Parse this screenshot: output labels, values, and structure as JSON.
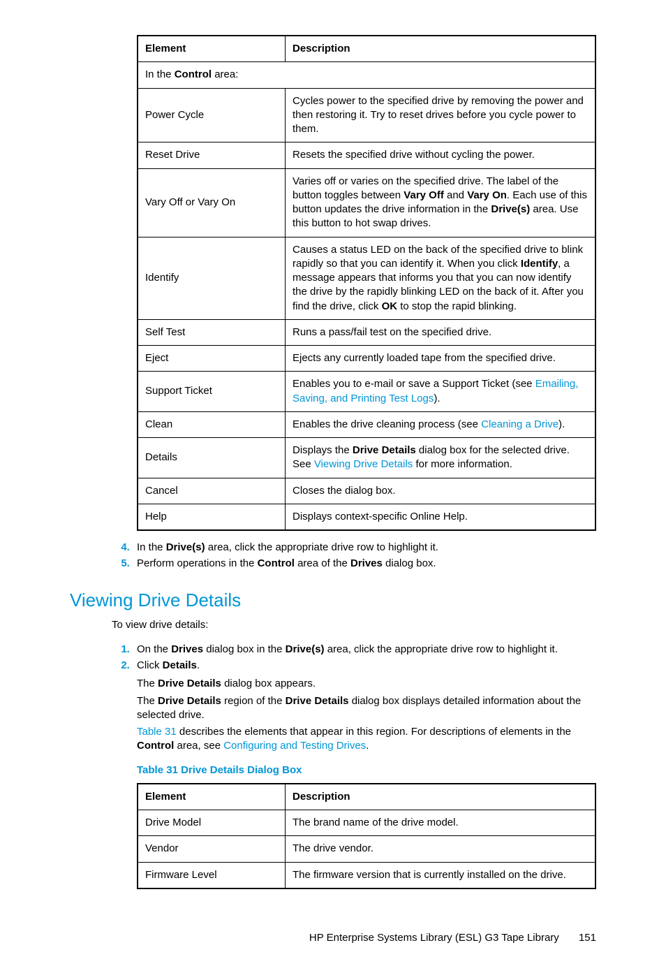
{
  "table1": {
    "headers": {
      "c1": "Element",
      "c2": "Description"
    },
    "subheader_pre": "In the ",
    "subheader_bold": "Control",
    "subheader_post": " area:",
    "rows": {
      "power_cycle": {
        "el": "Power Cycle",
        "desc": "Cycles power to the specified drive by removing the power and then restoring it. Try to reset drives before you cycle power to them."
      },
      "reset_drive": {
        "el": "Reset Drive",
        "desc": "Resets the specified drive without cycling the power."
      },
      "vary": {
        "el": "Vary Off or Vary On",
        "d_pre": "Varies off or varies on the specified drive. The label of the button toggles between ",
        "d_b1": "Vary Off",
        "d_mid1": " and ",
        "d_b2": "Vary On",
        "d_mid2": ". Each use of this button updates the drive information in the ",
        "d_b3": "Drive(s)",
        "d_post": " area. Use this button to hot swap drives."
      },
      "identify": {
        "el": "Identify",
        "d_pre": "Causes a status LED on the back of the specified drive to blink rapidly so that you can identify it. When you click ",
        "d_b1": "Identify",
        "d_mid": ", a message appears that informs you that you can now identify the drive by the rapidly blinking LED on the back of it. After you find the drive, click ",
        "d_b2": "OK",
        "d_post": " to stop the rapid blinking."
      },
      "self_test": {
        "el": "Self Test",
        "desc": "Runs a pass/fail test on the specified drive."
      },
      "eject": {
        "el": "Eject",
        "desc": "Ejects any currently loaded tape from the specified drive."
      },
      "support": {
        "el": "Support Ticket",
        "d_pre": "Enables you to e-mail or save a Support Ticket (see ",
        "d_link": "Emailing, Saving, and Printing Test Logs",
        "d_post": ")."
      },
      "clean": {
        "el": "Clean",
        "d_pre": "Enables the drive cleaning process (see ",
        "d_link": "Cleaning a Drive",
        "d_post": ")."
      },
      "details": {
        "el": "Details",
        "d_pre": "Displays the ",
        "d_b": "Drive Details",
        "d_mid": " dialog box for the selected drive. See ",
        "d_link": "Viewing Drive Details",
        "d_post": " for more information."
      },
      "cancel": {
        "el": "Cancel",
        "desc": "Closes the dialog box."
      },
      "help": {
        "el": "Help",
        "desc": "Displays context-specific Online Help."
      }
    }
  },
  "steps_a": {
    "s4_pre": "In the ",
    "s4_b": "Drive(s)",
    "s4_post": " area, click the appropriate drive row to highlight it.",
    "s5_pre": "Perform operations in the ",
    "s5_b1": "Control",
    "s5_mid": " area of the ",
    "s5_b2": "Drives",
    "s5_post": " dialog box."
  },
  "section": {
    "title": "Viewing Drive Details",
    "intro": "To view drive details:",
    "s1_pre": "On the ",
    "s1_b1": "Drives",
    "s1_mid1": " dialog box in the ",
    "s1_b2": "Drive(s)",
    "s1_post": " area, click the appropriate drive row to highlight it.",
    "s2_pre": "Click ",
    "s2_b": "Details",
    "s2_post": ".",
    "p1_pre": "The ",
    "p1_b": "Drive Details",
    "p1_post": " dialog box appears.",
    "p2_pre": "The ",
    "p2_b1": "Drive Details",
    "p2_mid": " region of the ",
    "p2_b2": "Drive Details",
    "p2_post": " dialog box displays detailed information about the selected drive.",
    "p3_link": "Table 31",
    "p3_mid": " describes the elements that appear in this region. For descriptions of elements in the ",
    "p3_b": "Control",
    "p3_post1": " area, see ",
    "p3_link2": "Configuring and Testing Drives",
    "p3_post2": "."
  },
  "table2": {
    "title": "Table 31 Drive Details Dialog Box",
    "headers": {
      "c1": "Element",
      "c2": "Description"
    },
    "rows": {
      "drive_model": {
        "el": "Drive Model",
        "desc": "The brand name of the drive model."
      },
      "vendor": {
        "el": "Vendor",
        "desc": "The drive vendor."
      },
      "firmware": {
        "el": "Firmware Level",
        "desc": "The firmware version that is currently installed on the drive."
      }
    }
  },
  "footer": {
    "doc": "HP Enterprise Systems Library (ESL) G3 Tape Library",
    "page": "151"
  }
}
